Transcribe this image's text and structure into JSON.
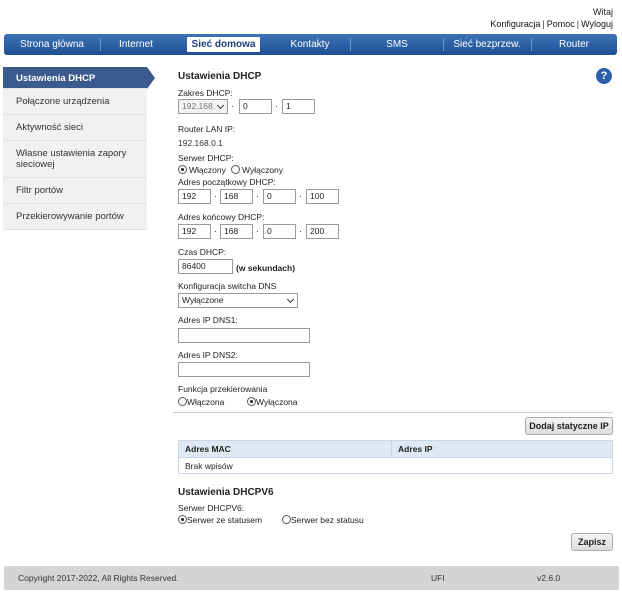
{
  "header": {
    "welcome": "Witaj",
    "links": [
      "Konfiguracja",
      "Pomoc",
      "Wyloguj"
    ],
    "separator": "|"
  },
  "nav": {
    "items": [
      "Strona główna",
      "Internet",
      "Sieć domowa",
      "Kontakty",
      "SMS",
      "Sieć bezprzew.",
      "Router"
    ],
    "active": "Sieć domowa"
  },
  "sidebar": {
    "items": [
      "Ustawienia DHCP",
      "Połączone urządzenia",
      "Aktywność sieci",
      "Własne ustawienia zapory sieciowej",
      "Filtr portów",
      "Przekierowywanie portów"
    ],
    "active": "Ustawienia DHCP"
  },
  "help": {
    "glyph": "?"
  },
  "dhcp": {
    "title": "Ustawienia DHCP",
    "range_label": "Zakres DHCP:",
    "range_prefix": "192.168.",
    "range_octet3": "0",
    "range_octet4": "1",
    "dot": "·",
    "router_ip_label": "Router LAN IP:",
    "router_ip_value": "192.168.0.1",
    "server_label": "Serwer DHCP:",
    "server_on": "Włączony",
    "server_off": "Wyłączony",
    "start_label": "Adres początkowy DHCP:",
    "start": [
      "192",
      "168",
      "0",
      "100"
    ],
    "end_label": "Adres końcowy DHCP:",
    "end": [
      "192",
      "168",
      "0",
      "200"
    ],
    "lease_label": "Czas DHCP:",
    "lease_value": "86400",
    "lease_unit": "(w sekundach)",
    "dns_switch_label": "Konfiguracja switcha DNS",
    "dns_switch_value": "Wyłączone",
    "dns1_label": "Adres IP DNS1:",
    "dns1_value": "",
    "dns2_label": "Adres IP DNS2:",
    "dns2_value": "",
    "forward_label": "Funkcja przekierowania",
    "forward_on": "Włączona",
    "forward_off": "Wyłączona",
    "add_static_button": "Dodaj statyczne IP",
    "table_headers": [
      "Adres MAC",
      "Adres IP"
    ],
    "table_empty": "Brak wpisów"
  },
  "dhcpv6": {
    "title": "Ustawienia DHCPV6",
    "server_label": "Serwer DHCPV6:",
    "stateful": "Serwer ze statusem",
    "stateless": "Serwer bez statusu",
    "save_button": "Zapisz"
  },
  "footer": {
    "copyright": "Copyright 2017-2022, All Rights Reserved.",
    "middle": "UFI",
    "version": "v2.6.0"
  }
}
